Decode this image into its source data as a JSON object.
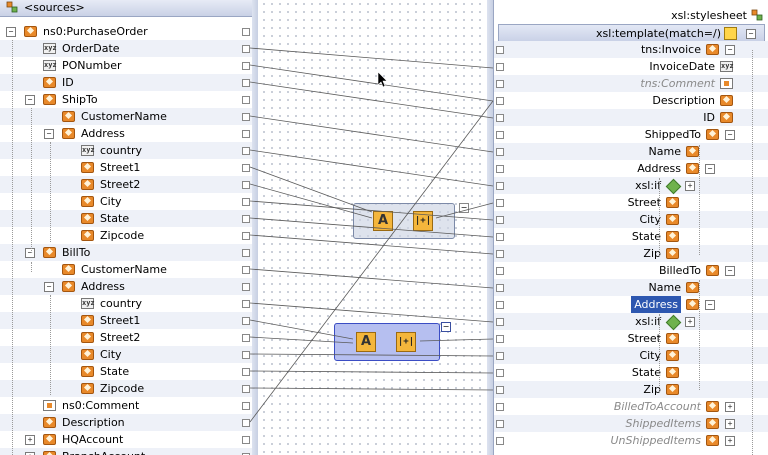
{
  "sources": {
    "header": "<sources>",
    "items": [
      {
        "label": "ns0:PurchaseOrder",
        "icon": "element-icon"
      },
      {
        "label": "OrderDate",
        "icon": "attribute-icon"
      },
      {
        "label": "PONumber",
        "icon": "attribute-icon"
      },
      {
        "label": "ID",
        "icon": "element-icon"
      },
      {
        "label": "ShipTo",
        "icon": "element-icon"
      },
      {
        "label": "CustomerName",
        "icon": "element-icon"
      },
      {
        "label": "Address",
        "icon": "element-icon"
      },
      {
        "label": "country",
        "icon": "attribute-icon"
      },
      {
        "label": "Street1",
        "icon": "element-icon"
      },
      {
        "label": "Street2",
        "icon": "element-icon"
      },
      {
        "label": "City",
        "icon": "element-icon"
      },
      {
        "label": "State",
        "icon": "element-icon"
      },
      {
        "label": "Zipcode",
        "icon": "element-icon"
      },
      {
        "label": "BillTo",
        "icon": "element-icon"
      },
      {
        "label": "CustomerName",
        "icon": "element-icon"
      },
      {
        "label": "Address",
        "icon": "element-icon"
      },
      {
        "label": "country",
        "icon": "attribute-icon"
      },
      {
        "label": "Street1",
        "icon": "element-icon"
      },
      {
        "label": "Street2",
        "icon": "element-icon"
      },
      {
        "label": "City",
        "icon": "element-icon"
      },
      {
        "label": "State",
        "icon": "element-icon"
      },
      {
        "label": "Zipcode",
        "icon": "element-icon"
      },
      {
        "label": "ns0:Comment",
        "icon": "comment-icon"
      },
      {
        "label": "Description",
        "icon": "element-icon"
      },
      {
        "label": "HQAccount",
        "icon": "element-icon"
      },
      {
        "label": "BranchAccount",
        "icon": "element-icon"
      }
    ]
  },
  "target": {
    "header": "xsl:stylesheet",
    "template": "xsl:template(match=/)",
    "items": [
      {
        "label": "tns:Invoice",
        "icon": "element-icon"
      },
      {
        "label": "InvoiceDate",
        "icon": "attribute-icon"
      },
      {
        "label": "tns:Comment",
        "icon": "comment-icon"
      },
      {
        "label": "Description",
        "icon": "element-icon"
      },
      {
        "label": "ID",
        "icon": "element-icon"
      },
      {
        "label": "ShippedTo",
        "icon": "element-icon"
      },
      {
        "label": "Name",
        "icon": "element-icon"
      },
      {
        "label": "Address",
        "icon": "element-icon"
      },
      {
        "label": "xsl:if",
        "icon": "xsl-if-icon"
      },
      {
        "label": "Street",
        "icon": "element-icon"
      },
      {
        "label": "City",
        "icon": "element-icon"
      },
      {
        "label": "State",
        "icon": "element-icon"
      },
      {
        "label": "Zip",
        "icon": "element-icon"
      },
      {
        "label": "BilledTo",
        "icon": "element-icon"
      },
      {
        "label": "Name",
        "icon": "element-icon"
      },
      {
        "label": "Address",
        "icon": "element-icon"
      },
      {
        "label": "xsl:if",
        "icon": "xsl-if-icon"
      },
      {
        "label": "Street",
        "icon": "element-icon"
      },
      {
        "label": "City",
        "icon": "element-icon"
      },
      {
        "label": "State",
        "icon": "element-icon"
      },
      {
        "label": "Zip",
        "icon": "element-icon"
      },
      {
        "label": "BilledToAccount",
        "icon": "element-icon"
      },
      {
        "label": "ShippedItems",
        "icon": "element-icon"
      },
      {
        "label": "UnShippedItems",
        "icon": "element-icon"
      }
    ]
  },
  "functions": {
    "concat_glyph": "A",
    "string_glyph": "|+|"
  },
  "colors": {
    "element": "#e8892a",
    "selection": "#2d57b0",
    "xsl_if": "#6fb24d",
    "function_box": "#f4b63c"
  }
}
